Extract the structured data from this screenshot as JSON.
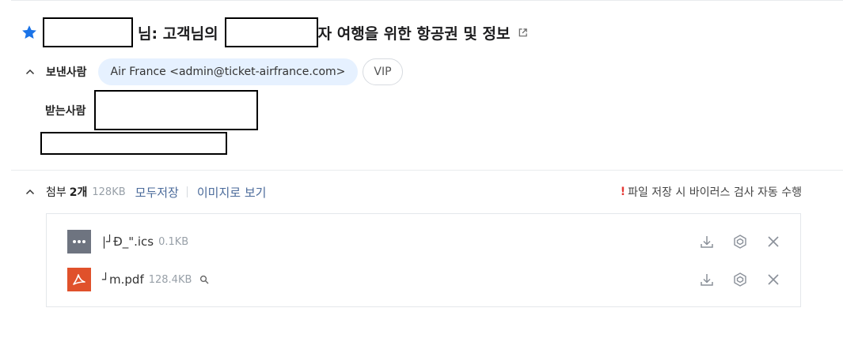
{
  "subject": {
    "prefix_suffix": "님: 고객님의",
    "suffix": "자 여행을 위한 항공권 및 정보"
  },
  "sender": {
    "label": "보낸사람",
    "name_email": "Air France <admin@ticket-airfrance.com>",
    "vip_label": "VIP"
  },
  "recipient": {
    "label": "받는사람"
  },
  "attachments": {
    "label": "첨부",
    "count": "2개",
    "total_size": "128KB",
    "save_all": "모두저장",
    "view_images": "이미지로 보기",
    "virus_notice": "파일 저장 시 바이러스 검사 자동 수행",
    "notice_mark": "!",
    "files": [
      {
        "name": "|┘Ð_\".ics",
        "size": "0.1KB",
        "icon": "more-dots-icon",
        "icon_color": "#6e7480"
      },
      {
        "name": "┘m.pdf",
        "size": "128.4KB",
        "icon": "pdf-icon",
        "icon_color": "#e0512b"
      }
    ]
  },
  "colors": {
    "star": "#1a73e8",
    "sender_chip": "#e6f1ff",
    "link": "#4a6a9a",
    "notice_mark": "#e53935"
  }
}
